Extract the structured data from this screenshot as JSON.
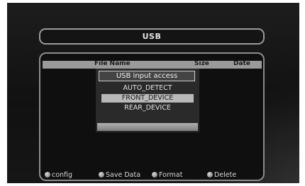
{
  "header": {
    "title": "USB"
  },
  "file_list": {
    "columns": [
      "File Name",
      "Size",
      "Date"
    ]
  },
  "popup": {
    "title": "USB input access",
    "options": [
      "AUTO_DETECT",
      "FRONT_DEVICE",
      "REAR_DEVICE"
    ],
    "selected": "FRONT_DEVICE"
  },
  "footer": {
    "config": "config",
    "save_data": "Save Data",
    "format": "Format",
    "delete": "Delete"
  }
}
